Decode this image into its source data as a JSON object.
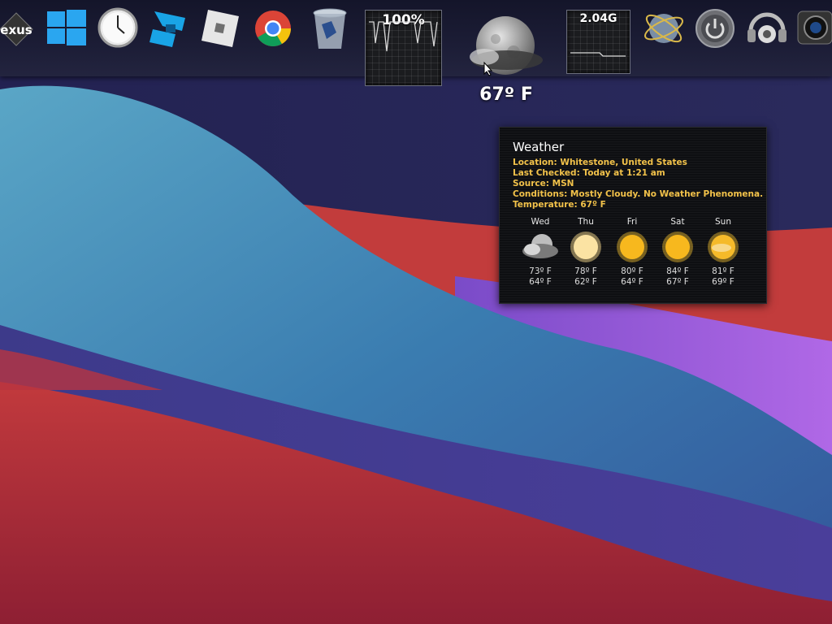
{
  "dock": {
    "items": [
      {
        "name": "nexus-logo",
        "label": "exus"
      },
      {
        "name": "windows-start"
      },
      {
        "name": "clock"
      },
      {
        "name": "roblox-studio"
      },
      {
        "name": "roblox"
      },
      {
        "name": "chrome"
      },
      {
        "name": "recycle-bin"
      }
    ],
    "cpu_meter": {
      "label": "100%",
      "value": 100
    },
    "weather": {
      "temperature": "67º F"
    },
    "network_meter": {
      "label": "2.04G"
    }
  },
  "weather_panel": {
    "title": "Weather",
    "location": "Location: Whitestone, United States",
    "last_checked": "Last Checked: Today at 1:21 am",
    "source": "Source: MSN",
    "conditions": "Conditions: Mostly Cloudy. No Weather Phenomena.",
    "temperature": "Temperature: 67º F",
    "forecast": [
      {
        "day": "Wed",
        "icon": "cloud-moon-icon",
        "high": "73º F",
        "low": "64º F"
      },
      {
        "day": "Thu",
        "icon": "hazy-sun-icon",
        "high": "78º F",
        "low": "62º F"
      },
      {
        "day": "Fri",
        "icon": "sun-icon",
        "high": "80º F",
        "low": "64º F"
      },
      {
        "day": "Sat",
        "icon": "sun-icon",
        "high": "84º F",
        "low": "67º F"
      },
      {
        "day": "Sun",
        "icon": "partly-sunny-icon",
        "high": "81º F",
        "low": "69º F"
      }
    ]
  },
  "colors": {
    "accent_text": "#f2c24a",
    "dock_bg": "#1c1d36",
    "wall_red": "#c03a3a",
    "wall_blue": "#3c86b0",
    "wall_purple": "#8a48d0"
  }
}
